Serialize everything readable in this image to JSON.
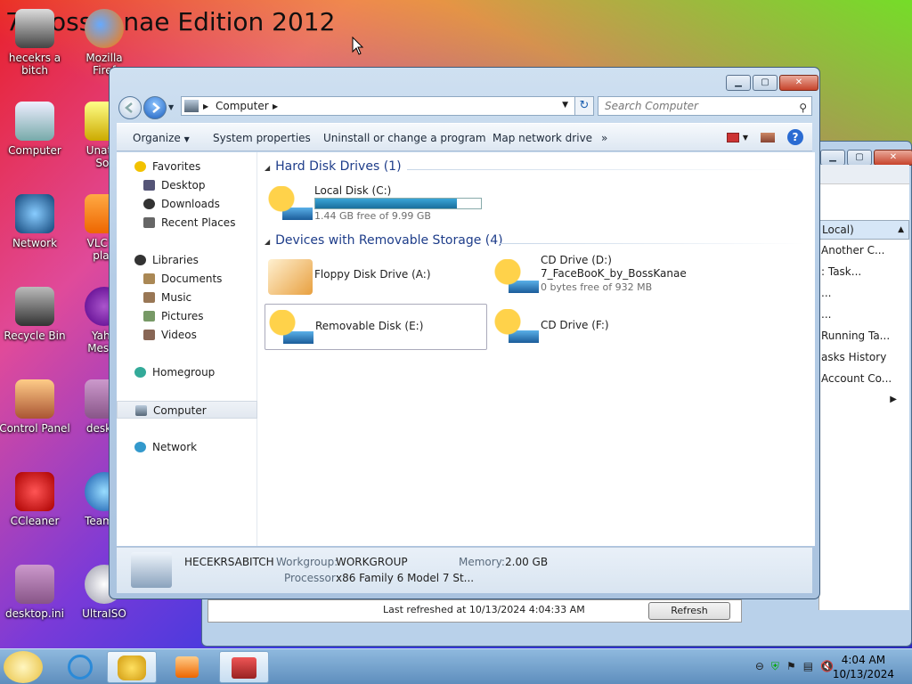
{
  "wallpaper": {
    "title": "7_BossKanae Edition 2012"
  },
  "desktop_icons": [
    {
      "label": "hecekrs a\nbitch"
    },
    {
      "label": "Mozilla\nFiref"
    },
    {
      "label": "Computer"
    },
    {
      "label": "Unatte\nSof"
    },
    {
      "label": "Network"
    },
    {
      "label": "VLC m\nplay"
    },
    {
      "label": "Recycle Bin"
    },
    {
      "label": "Yaho\nMesse"
    },
    {
      "label": "Control Panel"
    },
    {
      "label": "deskto"
    },
    {
      "label": "CCleaner"
    },
    {
      "label": "Team V"
    },
    {
      "label": "desktop.ini"
    },
    {
      "label": "UltraISO"
    }
  ],
  "back_window": {
    "rows": [
      "Local)",
      "Another C...",
      ": Task...",
      "...",
      "...",
      "Running Ta...",
      "asks History",
      "Account Co..."
    ],
    "status": "Last refreshed at 10/13/2024 4:04:33 AM",
    "refresh_label": "Refresh"
  },
  "explorer": {
    "address": {
      "segment": "Computer"
    },
    "search_placeholder": "Search Computer",
    "toolbar": {
      "organize": "Organize",
      "system_properties": "System properties",
      "uninstall": "Uninstall or change a program",
      "map_drive": "Map network drive",
      "more": "»"
    },
    "nav": {
      "favorites": "Favorites",
      "desktop": "Desktop",
      "downloads": "Downloads",
      "recent": "Recent Places",
      "libraries": "Libraries",
      "documents": "Documents",
      "music": "Music",
      "pictures": "Pictures",
      "videos": "Videos",
      "homegroup": "Homegroup",
      "computer": "Computer",
      "network": "Network"
    },
    "groups": {
      "hdd": "Hard Disk Drives (1)",
      "removable": "Devices with Removable Storage (4)"
    },
    "drives": {
      "c": {
        "name": "Local Disk (C:)",
        "space": "1.44 GB free of 9.99 GB",
        "used_fraction": 0.856
      },
      "a": {
        "name": "Floppy Disk Drive (A:)"
      },
      "d": {
        "name": "CD Drive (D:)",
        "label": "7_FaceBooK_by_BossKanae",
        "space": "0 bytes free of 932 MB"
      },
      "e": {
        "name": "Removable Disk (E:)"
      },
      "f": {
        "name": "CD Drive (F:)"
      }
    },
    "details": {
      "computer_name": "HECEKRSABITCH",
      "workgroup_label": "Workgroup:",
      "workgroup": "WORKGROUP",
      "memory_label": "Memory:",
      "memory": "2.00 GB",
      "processor_label": "Processor:",
      "processor": "x86 Family 6 Model 7 St..."
    }
  },
  "clock": {
    "time": "4:04 AM",
    "date": "10/13/2024"
  }
}
